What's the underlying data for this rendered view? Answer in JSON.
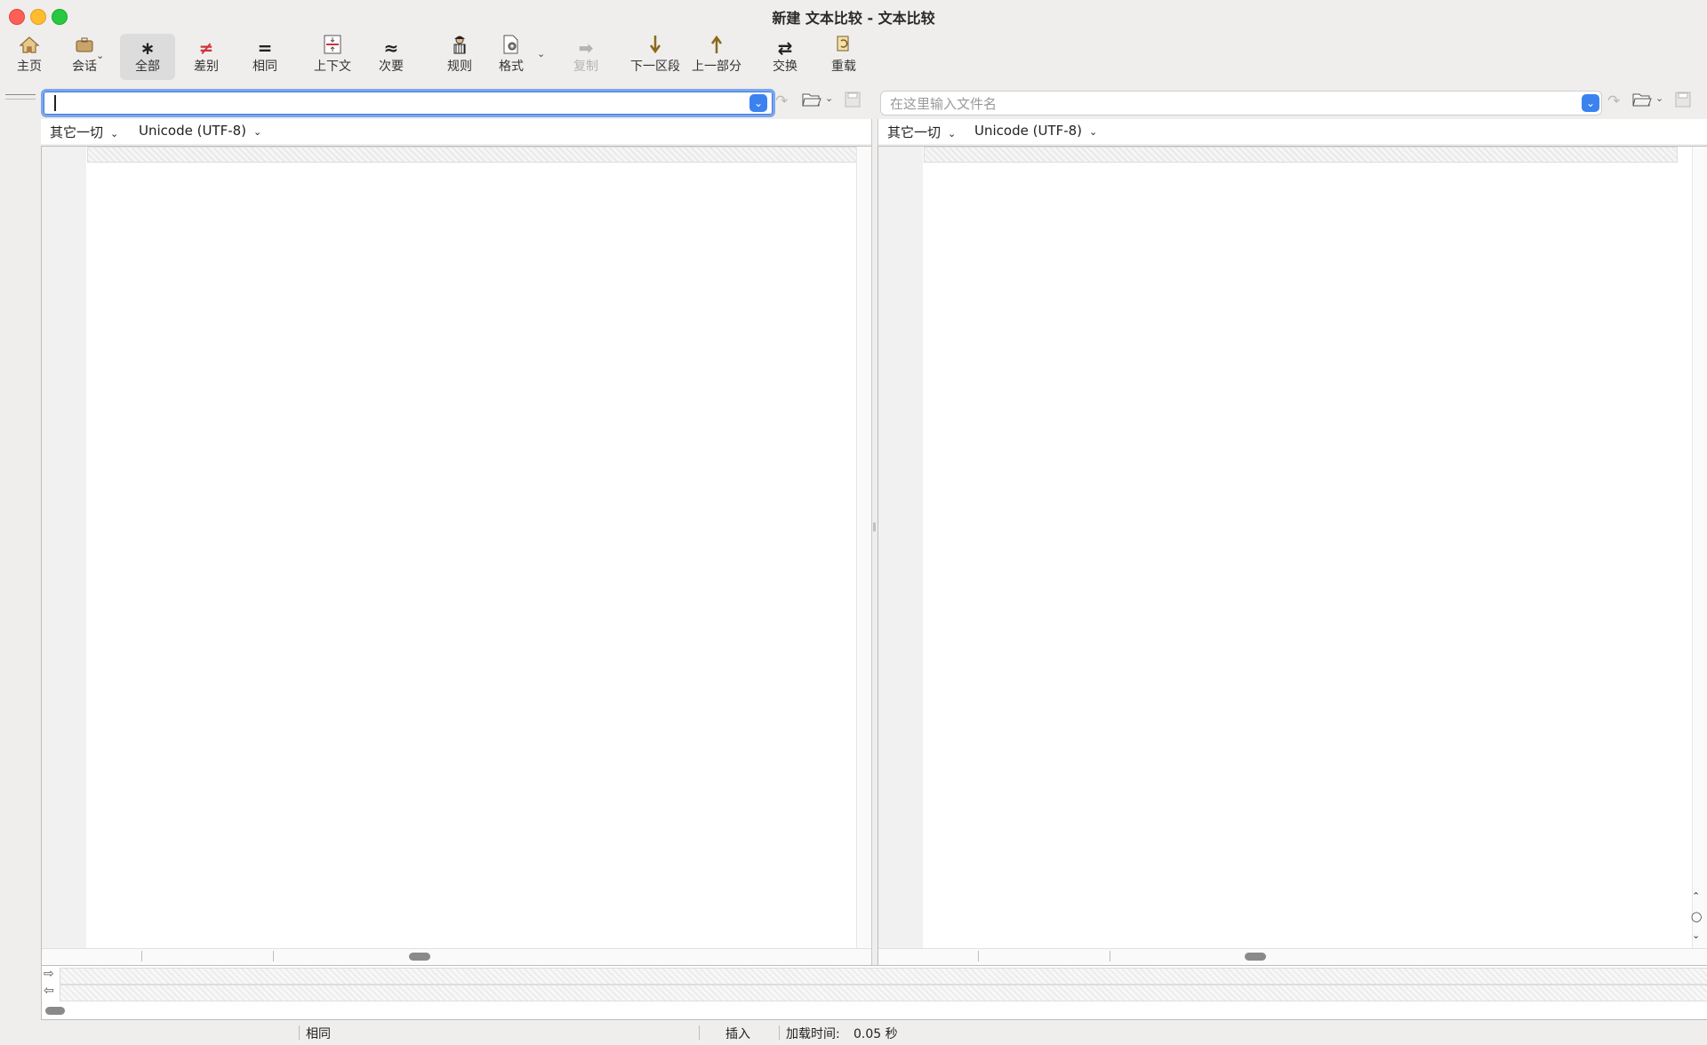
{
  "window": {
    "title": "新建 文本比较 - 文本比较"
  },
  "toolbar": {
    "home": "主页",
    "session": "会话",
    "all": "全部",
    "diffs": "差别",
    "same": "相同",
    "context": "上下文",
    "minor": "次要",
    "rules": "规则",
    "format": "格式",
    "copy": "复制",
    "next_section": "下一区段",
    "prev_section": "上一部分",
    "swap": "交换",
    "reload": "重载"
  },
  "left_pane": {
    "path_value": "",
    "path_placeholder": "",
    "format": "其它一切",
    "encoding": "Unicode (UTF-8)"
  },
  "right_pane": {
    "path_value": "",
    "path_placeholder": "在这里输入文件名",
    "format": "其它一切",
    "encoding": "Unicode (UTF-8)"
  },
  "status": {
    "mode": "相同",
    "insert": "插入",
    "load_time_label": "加载时间:",
    "load_time_value": "0.05 秒"
  },
  "colors": {
    "accent": "#3b82f0",
    "diff_red": "#d0343a"
  }
}
